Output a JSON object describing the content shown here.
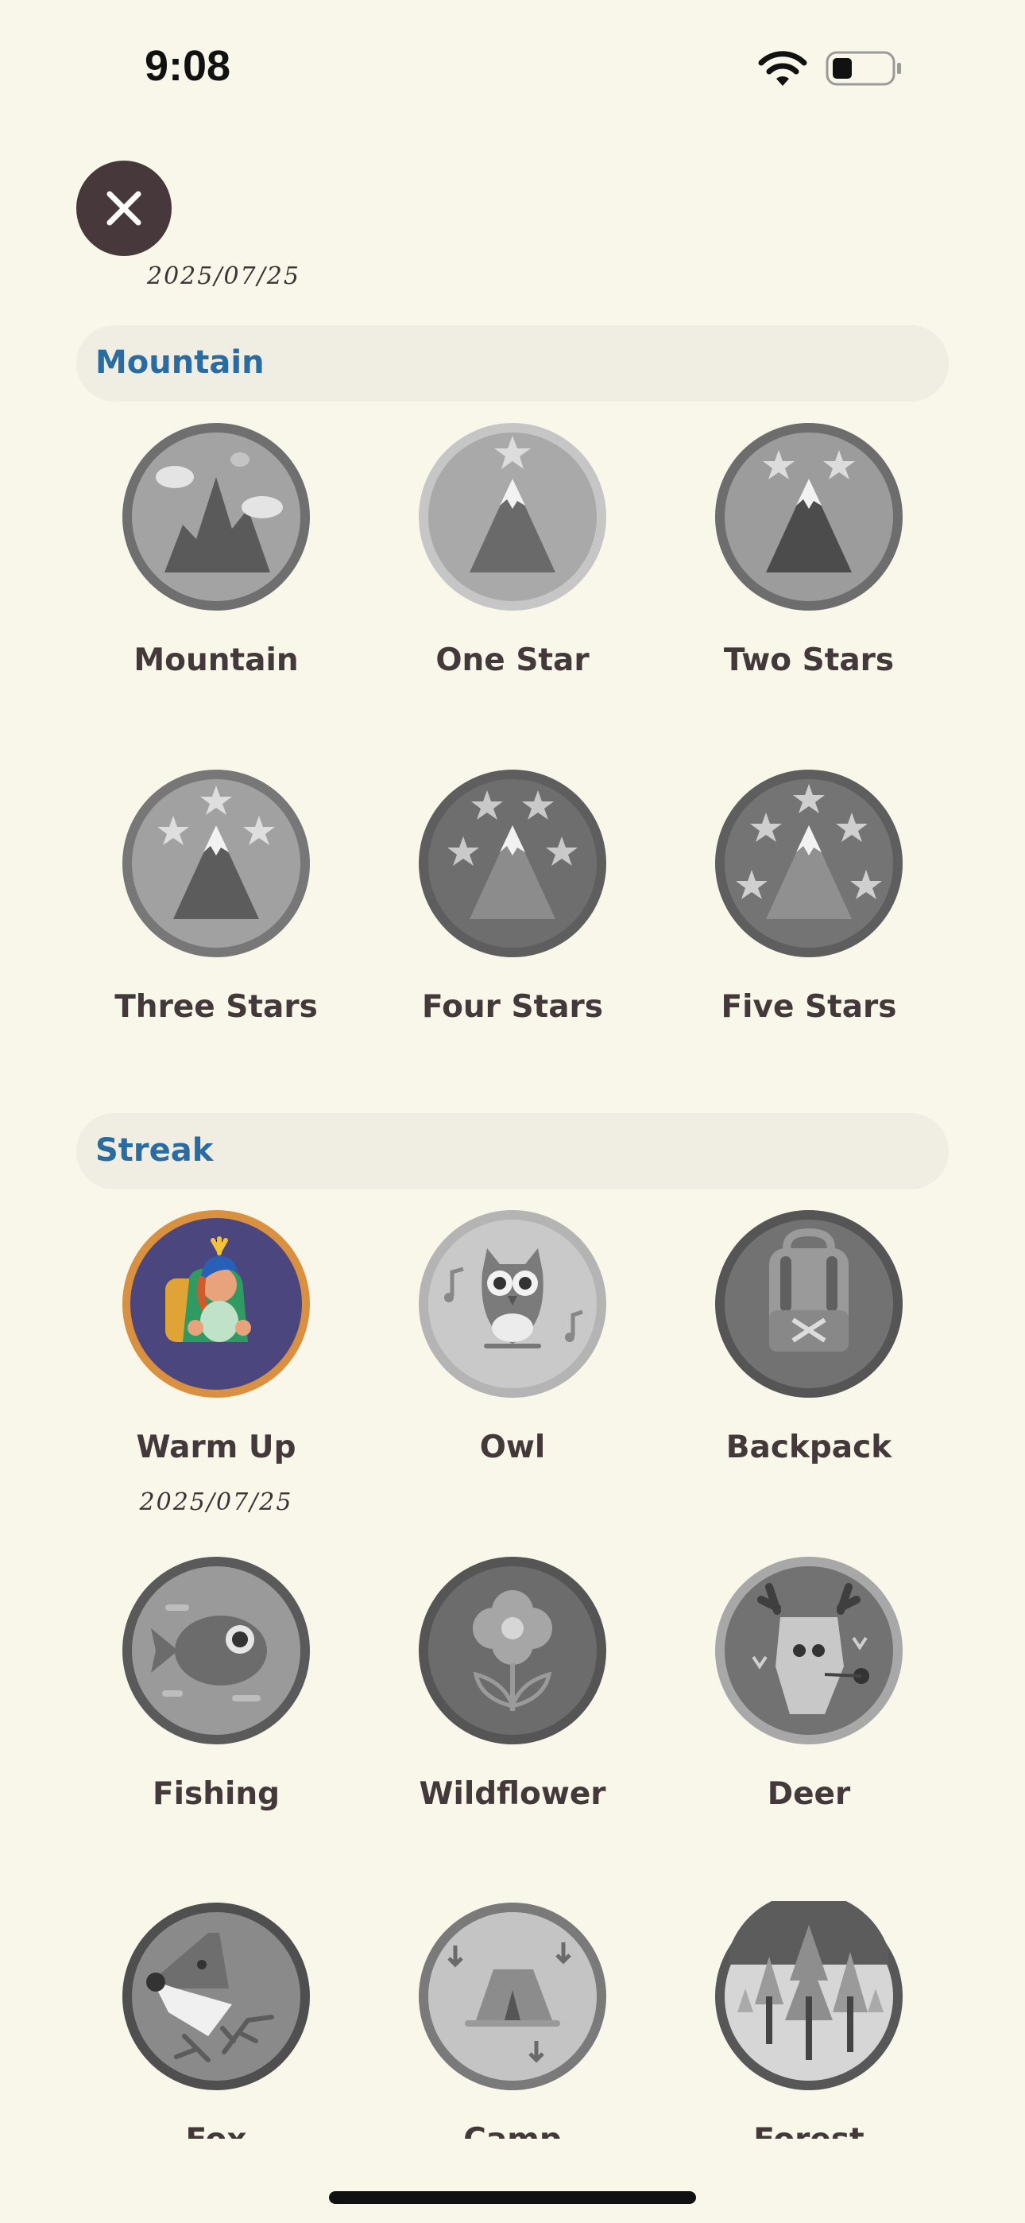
{
  "status_bar": {
    "time": "9:08"
  },
  "header": {
    "date": "2025/07/25"
  },
  "sections": [
    {
      "title": "Mountain",
      "badges": [
        {
          "label": "Mountain",
          "icon": "mountain-clouds-icon"
        },
        {
          "label": "One Star",
          "icon": "mountain-one-star-icon"
        },
        {
          "label": "Two Stars",
          "icon": "mountain-two-stars-icon"
        },
        {
          "label": "Three Stars",
          "icon": "mountain-three-stars-icon"
        },
        {
          "label": "Four Stars",
          "icon": "mountain-four-stars-icon"
        },
        {
          "label": "Five Stars",
          "icon": "mountain-five-stars-icon"
        }
      ]
    },
    {
      "title": "Streak",
      "badges": [
        {
          "label": "Warm Up",
          "icon": "hiker-icon",
          "date": "2025/07/25",
          "unlocked": true
        },
        {
          "label": "Owl",
          "icon": "owl-icon"
        },
        {
          "label": "Backpack",
          "icon": "backpack-icon"
        },
        {
          "label": "Fishing",
          "icon": "fish-icon"
        },
        {
          "label": "Wildflower",
          "icon": "flower-icon"
        },
        {
          "label": "Deer",
          "icon": "deer-icon"
        },
        {
          "label": "Fox",
          "icon": "fox-icon"
        },
        {
          "label": "Camp",
          "icon": "tent-icon"
        },
        {
          "label": "Forest",
          "icon": "forest-icon"
        }
      ]
    }
  ],
  "colors": {
    "background": "#f9f6ea",
    "section_title": "#2a6ca2",
    "section_bg": "#f0ede2",
    "locked_badge": "#8a8a8a",
    "unlocked_ring": "#d99040",
    "unlocked_fill": "#4c467e"
  }
}
